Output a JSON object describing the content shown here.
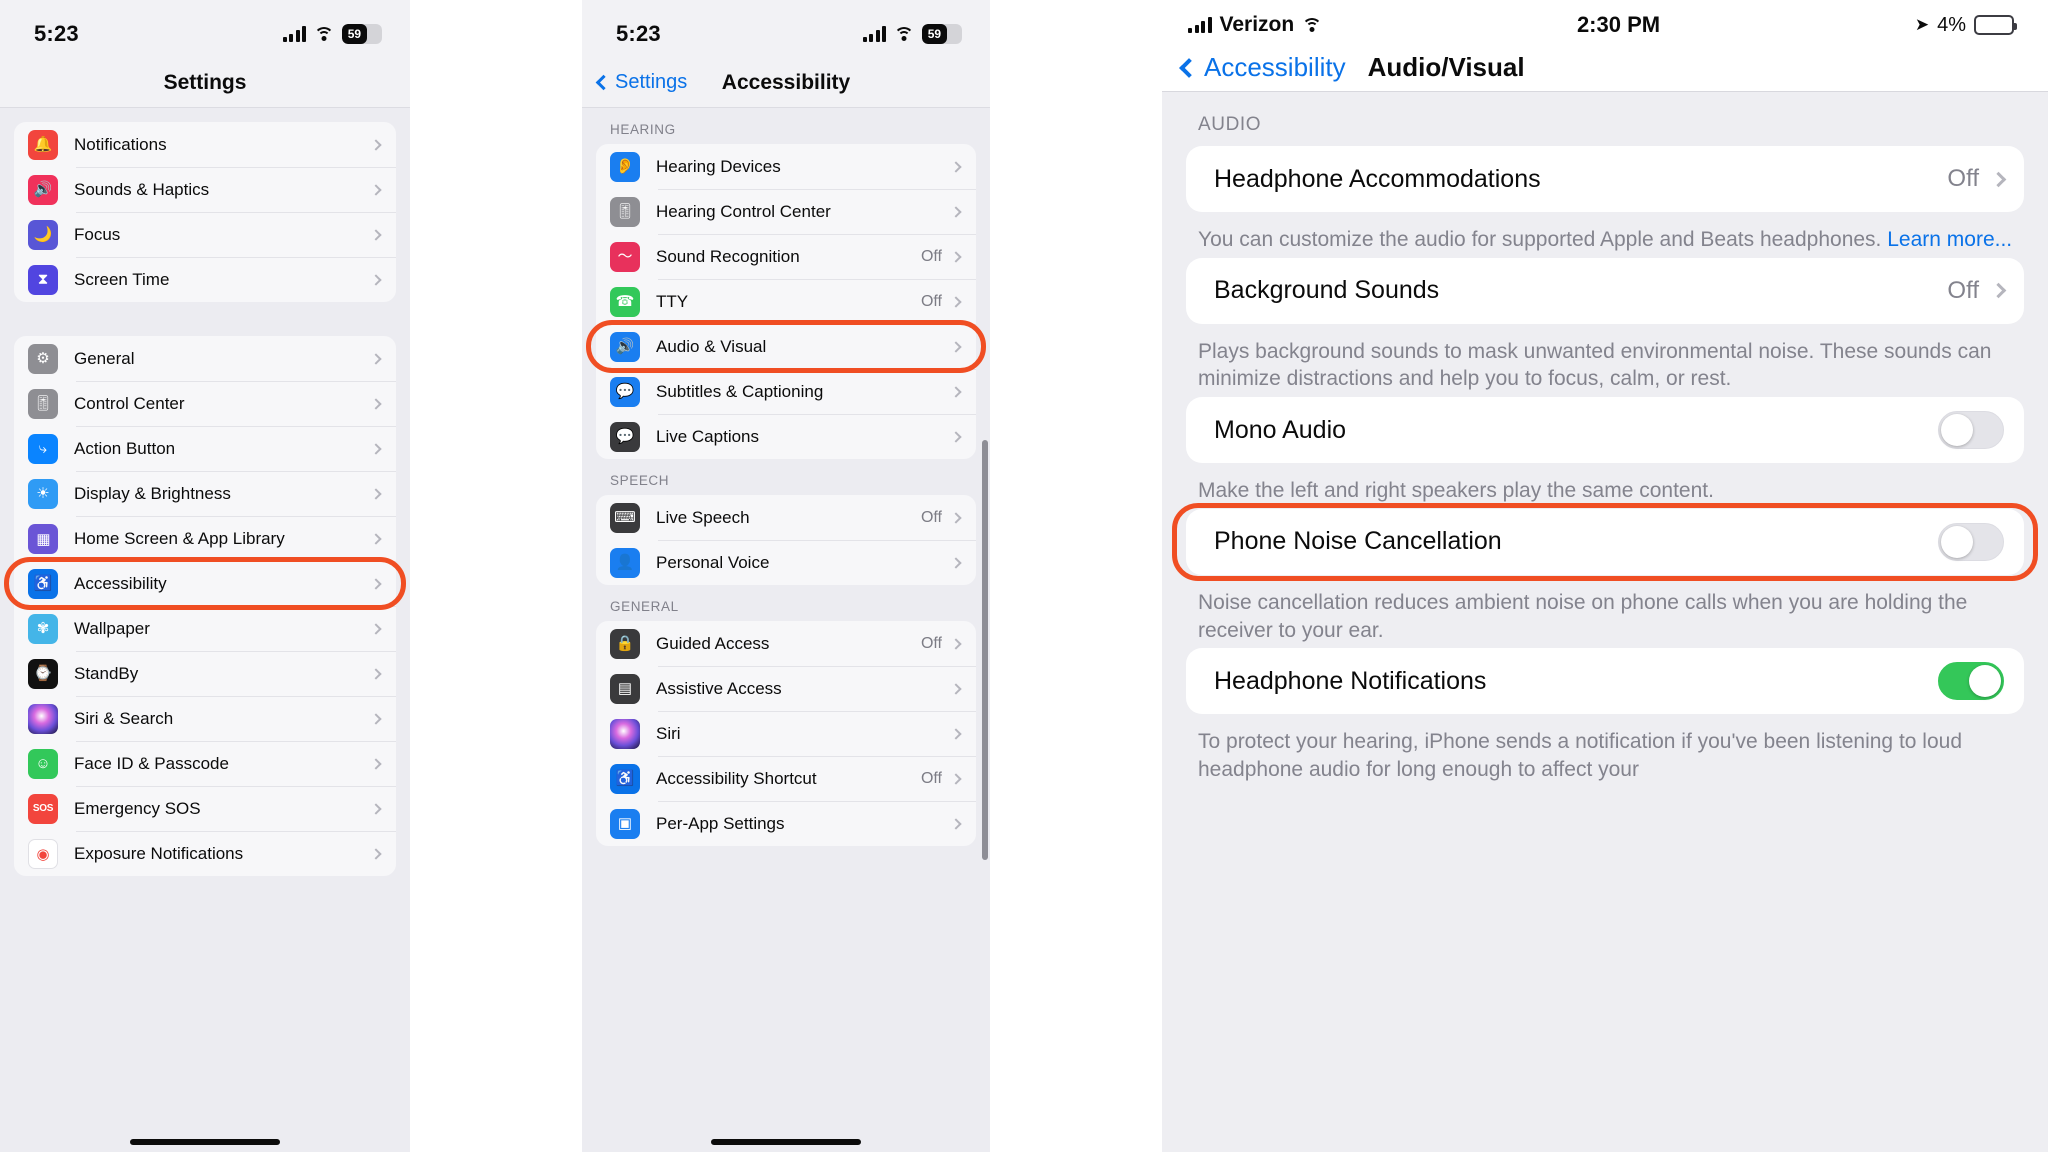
{
  "panel1": {
    "statusbar": {
      "time": "5:23",
      "battery": "59",
      "signal_icon": "cellular-bars-icon",
      "wifi_icon": "wifi-icon",
      "battery_icon": "battery-icon"
    },
    "nav": {
      "title": "Settings"
    },
    "group1": [
      {
        "label": "Notifications",
        "icon": "notifications-bell-icon",
        "value": ""
      },
      {
        "label": "Sounds & Haptics",
        "icon": "sounds-haptics-speaker-icon",
        "value": ""
      },
      {
        "label": "Focus",
        "icon": "focus-moon-icon",
        "value": ""
      },
      {
        "label": "Screen Time",
        "icon": "screen-time-hourglass-icon",
        "value": ""
      }
    ],
    "group2": [
      {
        "label": "General",
        "icon": "general-gear-icon",
        "value": ""
      },
      {
        "label": "Control Center",
        "icon": "control-center-sliders-icon",
        "value": ""
      },
      {
        "label": "Action Button",
        "icon": "action-button-icon",
        "value": ""
      },
      {
        "label": "Display & Brightness",
        "icon": "display-brightness-sun-icon",
        "value": ""
      },
      {
        "label": "Home Screen & App Library",
        "icon": "home-screen-grid-icon",
        "value": ""
      },
      {
        "label": "Accessibility",
        "icon": "accessibility-person-icon",
        "value": ""
      },
      {
        "label": "Wallpaper",
        "icon": "wallpaper-flower-icon",
        "value": ""
      },
      {
        "label": "StandBy",
        "icon": "standby-clock-icon",
        "value": ""
      },
      {
        "label": "Siri & Search",
        "icon": "siri-orb-icon",
        "value": ""
      },
      {
        "label": "Face ID & Passcode",
        "icon": "face-id-icon",
        "value": ""
      },
      {
        "label": "Emergency SOS",
        "icon": "emergency-sos-icon",
        "value": ""
      },
      {
        "label": "Exposure Notifications",
        "icon": "exposure-notifications-icon",
        "value": ""
      }
    ],
    "highlight": "Accessibility"
  },
  "panel2": {
    "statusbar": {
      "time": "5:23",
      "battery": "59"
    },
    "nav": {
      "back_label": "Settings",
      "title": "Accessibility"
    },
    "sections": [
      {
        "header": "HEARING",
        "rows": [
          {
            "label": "Hearing Devices",
            "icon": "hearing-devices-ear-icon",
            "value": ""
          },
          {
            "label": "Hearing Control Center",
            "icon": "hearing-control-center-icon",
            "value": ""
          },
          {
            "label": "Sound Recognition",
            "icon": "sound-recognition-icon",
            "value": "Off"
          },
          {
            "label": "TTY",
            "icon": "tty-phone-icon",
            "value": "Off"
          },
          {
            "label": "Audio & Visual",
            "icon": "audio-visual-icon",
            "value": ""
          },
          {
            "label": "Subtitles & Captioning",
            "icon": "subtitles-captioning-icon",
            "value": ""
          },
          {
            "label": "Live Captions",
            "icon": "live-captions-icon",
            "value": ""
          }
        ]
      },
      {
        "header": "SPEECH",
        "rows": [
          {
            "label": "Live Speech",
            "icon": "live-speech-icon",
            "value": "Off"
          },
          {
            "label": "Personal Voice",
            "icon": "personal-voice-icon",
            "value": ""
          }
        ]
      },
      {
        "header": "GENERAL",
        "rows": [
          {
            "label": "Guided Access",
            "icon": "guided-access-lock-icon",
            "value": "Off"
          },
          {
            "label": "Assistive Access",
            "icon": "assistive-access-icon",
            "value": ""
          },
          {
            "label": "Siri",
            "icon": "siri-orb-icon",
            "value": ""
          },
          {
            "label": "Accessibility Shortcut",
            "icon": "accessibility-shortcut-icon",
            "value": "Off"
          },
          {
            "label": "Per-App Settings",
            "icon": "per-app-settings-icon",
            "value": ""
          }
        ]
      }
    ],
    "highlight": "Audio & Visual"
  },
  "panel3": {
    "statusbar": {
      "carrier": "Verizon",
      "time": "2:30 PM",
      "battery_pct": "4%",
      "location_icon": "location-arrow-icon"
    },
    "nav": {
      "back_label": "Accessibility",
      "title": "Audio/Visual"
    },
    "section_header": "AUDIO",
    "rows": [
      {
        "type": "link",
        "label": "Headphone Accommodations",
        "value": "Off"
      },
      {
        "type": "desc",
        "text": "You can customize the audio for supported Apple and Beats headphones. ",
        "link": "Learn more..."
      },
      {
        "type": "link",
        "label": "Background Sounds",
        "value": "Off"
      },
      {
        "type": "desc",
        "text": "Plays background sounds to mask unwanted environmental noise. These sounds can minimize distractions and help you to focus, calm, or rest.",
        "link": ""
      },
      {
        "type": "toggle",
        "label": "Mono Audio",
        "on": false
      },
      {
        "type": "desc",
        "text": "Make the left and right speakers play the same content.",
        "link": ""
      },
      {
        "type": "toggle",
        "label": "Phone Noise Cancellation",
        "on": false
      },
      {
        "type": "desc",
        "text": "Noise cancellation reduces ambient noise on phone calls when you are holding the receiver to your ear.",
        "link": ""
      },
      {
        "type": "toggle",
        "label": "Headphone Notifications",
        "on": true
      },
      {
        "type": "desc",
        "text": "To protect your hearing, iPhone sends a notification if you've been listening to loud headphone audio for long enough to affect your",
        "link": ""
      }
    ],
    "highlight": "Phone Noise Cancellation"
  },
  "colors": {
    "accent_highlight": "#f04e23",
    "ios_blue": "#0a72e8",
    "toggle_on": "#34c759"
  }
}
